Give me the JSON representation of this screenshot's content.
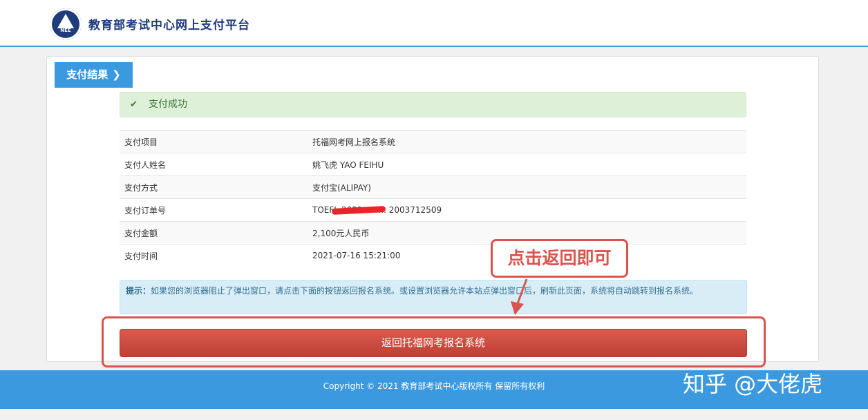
{
  "header": {
    "logo_text": "NEE",
    "site_title": "教育部考试中心网上支付平台"
  },
  "result": {
    "tab_label": "支付结果",
    "tab_chevron": "❯",
    "success_icon": "check-icon",
    "success_message": "支付成功"
  },
  "details": [
    {
      "label": "支付项目",
      "value": "托福网考网上报名系统"
    },
    {
      "label": "支付人姓名",
      "value": "姚飞虎   YAO FEIHU"
    },
    {
      "label": "支付方式",
      "value": "支付宝(ALIPAY)"
    },
    {
      "label": "支付订单号",
      "value": "TOEFL-2021 ........ 2003712509"
    },
    {
      "label": "支付金额",
      "value": "2,100元人民币"
    },
    {
      "label": "支付时间",
      "value": "2021-07-16 15:21:00"
    }
  ],
  "tip": {
    "label": "提示：",
    "text": "如果您的浏览器阻止了弹出窗口，请点击下面的按钮返回报名系统。或设置浏览器允许本站点弹出窗口后，刷新此页面，系统将自动跳转到报名系统。"
  },
  "return_button_label": "返回托福网考报名系统",
  "annotation": {
    "text": "点击返回即可",
    "color": "#d9534f"
  },
  "footer": {
    "copyright": "Copyright © 2021 教育部考试中心版权所有 保留所有权利",
    "watermark": "知乎 @大佬虎"
  },
  "colors": {
    "primary": "#3b99e0",
    "success_bg": "#dff0d8",
    "info_bg": "#d9edf7",
    "danger": "#c9473c"
  }
}
